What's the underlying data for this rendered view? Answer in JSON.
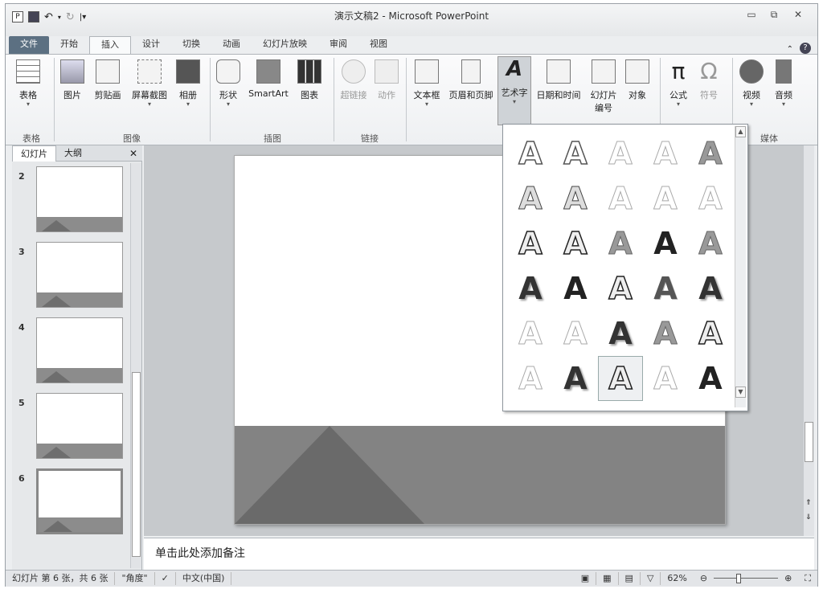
{
  "title": "演示文稿2 - Microsoft PowerPoint",
  "qat": {
    "app_icon": "P"
  },
  "tabs": [
    "文件",
    "开始",
    "插入",
    "设计",
    "切换",
    "动画",
    "幻灯片放映",
    "审阅",
    "视图"
  ],
  "ribbon": {
    "table": "表格",
    "picture": "图片",
    "clipart": "剪贴画",
    "screenshot": "屏幕截图",
    "album": "相册",
    "shapes": "形状",
    "smartart": "SmartArt",
    "chart": "图表",
    "hyperlink": "超链接",
    "action": "动作",
    "textbox": "文本框",
    "header_footer": "页眉和页脚",
    "wordart": "艺术字",
    "datetime": "日期和时间",
    "slide_num": "幻灯片",
    "slide_num2": "编号",
    "object": "对象",
    "equation": "公式",
    "symbol": "符号",
    "video": "视频",
    "audio": "音频",
    "groups": {
      "tables": "表格",
      "images": "图像",
      "illustrations": "插图",
      "links": "链接",
      "media": "媒体"
    }
  },
  "panel": {
    "tab_slides": "幻灯片",
    "tab_outline": "大纲",
    "close": "✕",
    "slides": [
      "2",
      "3",
      "4",
      "5",
      "6"
    ]
  },
  "notes": "单击此处添加备注",
  "status": {
    "slide": "幻灯片 第 6 张，共 6 张",
    "theme": "\"角度\"",
    "lang": "中文(中国)",
    "zoom": "62%"
  },
  "wordart_glyph": "A"
}
